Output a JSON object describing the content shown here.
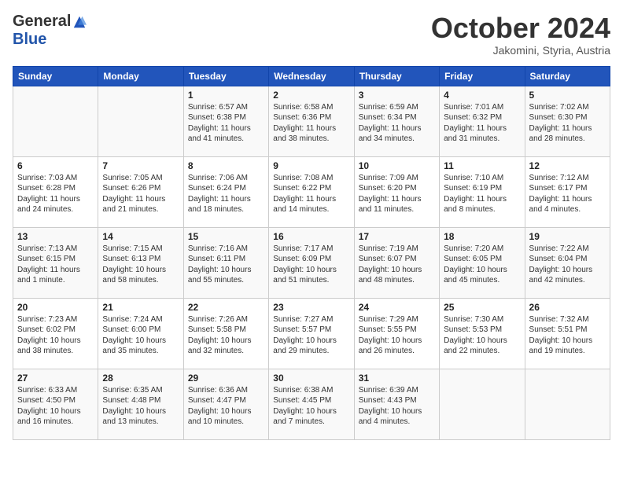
{
  "header": {
    "logo_general": "General",
    "logo_blue": "Blue",
    "month_title": "October 2024",
    "subtitle": "Jakomini, Styria, Austria"
  },
  "days_of_week": [
    "Sunday",
    "Monday",
    "Tuesday",
    "Wednesday",
    "Thursday",
    "Friday",
    "Saturday"
  ],
  "weeks": [
    [
      {
        "day": "",
        "info": ""
      },
      {
        "day": "",
        "info": ""
      },
      {
        "day": "1",
        "info": "Sunrise: 6:57 AM\nSunset: 6:38 PM\nDaylight: 11 hours and 41 minutes."
      },
      {
        "day": "2",
        "info": "Sunrise: 6:58 AM\nSunset: 6:36 PM\nDaylight: 11 hours and 38 minutes."
      },
      {
        "day": "3",
        "info": "Sunrise: 6:59 AM\nSunset: 6:34 PM\nDaylight: 11 hours and 34 minutes."
      },
      {
        "day": "4",
        "info": "Sunrise: 7:01 AM\nSunset: 6:32 PM\nDaylight: 11 hours and 31 minutes."
      },
      {
        "day": "5",
        "info": "Sunrise: 7:02 AM\nSunset: 6:30 PM\nDaylight: 11 hours and 28 minutes."
      }
    ],
    [
      {
        "day": "6",
        "info": "Sunrise: 7:03 AM\nSunset: 6:28 PM\nDaylight: 11 hours and 24 minutes."
      },
      {
        "day": "7",
        "info": "Sunrise: 7:05 AM\nSunset: 6:26 PM\nDaylight: 11 hours and 21 minutes."
      },
      {
        "day": "8",
        "info": "Sunrise: 7:06 AM\nSunset: 6:24 PM\nDaylight: 11 hours and 18 minutes."
      },
      {
        "day": "9",
        "info": "Sunrise: 7:08 AM\nSunset: 6:22 PM\nDaylight: 11 hours and 14 minutes."
      },
      {
        "day": "10",
        "info": "Sunrise: 7:09 AM\nSunset: 6:20 PM\nDaylight: 11 hours and 11 minutes."
      },
      {
        "day": "11",
        "info": "Sunrise: 7:10 AM\nSunset: 6:19 PM\nDaylight: 11 hours and 8 minutes."
      },
      {
        "day": "12",
        "info": "Sunrise: 7:12 AM\nSunset: 6:17 PM\nDaylight: 11 hours and 4 minutes."
      }
    ],
    [
      {
        "day": "13",
        "info": "Sunrise: 7:13 AM\nSunset: 6:15 PM\nDaylight: 11 hours and 1 minute."
      },
      {
        "day": "14",
        "info": "Sunrise: 7:15 AM\nSunset: 6:13 PM\nDaylight: 10 hours and 58 minutes."
      },
      {
        "day": "15",
        "info": "Sunrise: 7:16 AM\nSunset: 6:11 PM\nDaylight: 10 hours and 55 minutes."
      },
      {
        "day": "16",
        "info": "Sunrise: 7:17 AM\nSunset: 6:09 PM\nDaylight: 10 hours and 51 minutes."
      },
      {
        "day": "17",
        "info": "Sunrise: 7:19 AM\nSunset: 6:07 PM\nDaylight: 10 hours and 48 minutes."
      },
      {
        "day": "18",
        "info": "Sunrise: 7:20 AM\nSunset: 6:05 PM\nDaylight: 10 hours and 45 minutes."
      },
      {
        "day": "19",
        "info": "Sunrise: 7:22 AM\nSunset: 6:04 PM\nDaylight: 10 hours and 42 minutes."
      }
    ],
    [
      {
        "day": "20",
        "info": "Sunrise: 7:23 AM\nSunset: 6:02 PM\nDaylight: 10 hours and 38 minutes."
      },
      {
        "day": "21",
        "info": "Sunrise: 7:24 AM\nSunset: 6:00 PM\nDaylight: 10 hours and 35 minutes."
      },
      {
        "day": "22",
        "info": "Sunrise: 7:26 AM\nSunset: 5:58 PM\nDaylight: 10 hours and 32 minutes."
      },
      {
        "day": "23",
        "info": "Sunrise: 7:27 AM\nSunset: 5:57 PM\nDaylight: 10 hours and 29 minutes."
      },
      {
        "day": "24",
        "info": "Sunrise: 7:29 AM\nSunset: 5:55 PM\nDaylight: 10 hours and 26 minutes."
      },
      {
        "day": "25",
        "info": "Sunrise: 7:30 AM\nSunset: 5:53 PM\nDaylight: 10 hours and 22 minutes."
      },
      {
        "day": "26",
        "info": "Sunrise: 7:32 AM\nSunset: 5:51 PM\nDaylight: 10 hours and 19 minutes."
      }
    ],
    [
      {
        "day": "27",
        "info": "Sunrise: 6:33 AM\nSunset: 4:50 PM\nDaylight: 10 hours and 16 minutes."
      },
      {
        "day": "28",
        "info": "Sunrise: 6:35 AM\nSunset: 4:48 PM\nDaylight: 10 hours and 13 minutes."
      },
      {
        "day": "29",
        "info": "Sunrise: 6:36 AM\nSunset: 4:47 PM\nDaylight: 10 hours and 10 minutes."
      },
      {
        "day": "30",
        "info": "Sunrise: 6:38 AM\nSunset: 4:45 PM\nDaylight: 10 hours and 7 minutes."
      },
      {
        "day": "31",
        "info": "Sunrise: 6:39 AM\nSunset: 4:43 PM\nDaylight: 10 hours and 4 minutes."
      },
      {
        "day": "",
        "info": ""
      },
      {
        "day": "",
        "info": ""
      }
    ]
  ]
}
